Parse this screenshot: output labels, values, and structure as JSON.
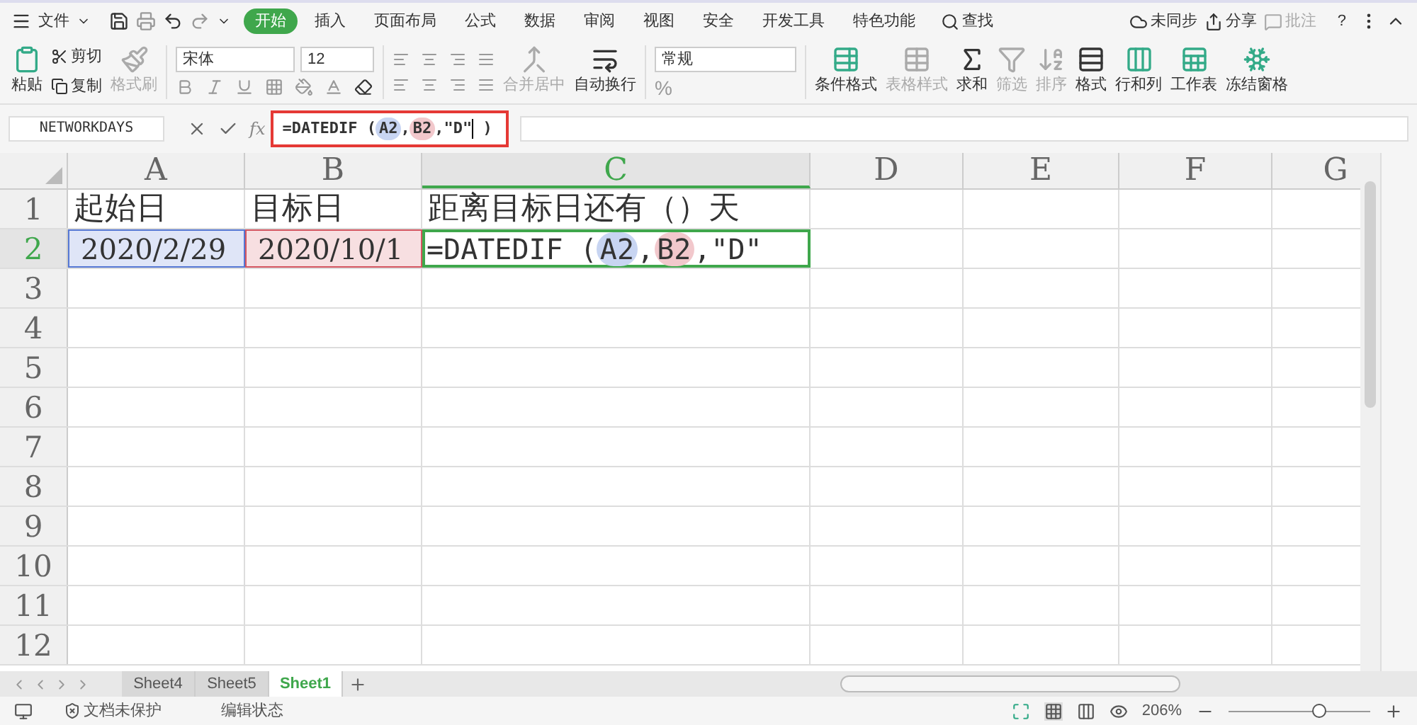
{
  "menu": {
    "file": "文件",
    "tabs": [
      {
        "label": "开始",
        "selected": true
      },
      {
        "label": "插入",
        "selected": false
      },
      {
        "label": "页面布局",
        "selected": false
      },
      {
        "label": "公式",
        "selected": false
      },
      {
        "label": "数据",
        "selected": false
      },
      {
        "label": "审阅",
        "selected": false
      },
      {
        "label": "视图",
        "selected": false
      },
      {
        "label": "安全",
        "selected": false
      },
      {
        "label": "开发工具",
        "selected": false
      },
      {
        "label": "特色功能",
        "selected": false
      }
    ],
    "search": "查找",
    "actions": [
      {
        "label": "未同步",
        "disabled": false
      },
      {
        "label": "分享",
        "disabled": false
      },
      {
        "label": "批注",
        "disabled": true
      }
    ],
    "help": "?"
  },
  "ribbon": {
    "paste": {
      "label": "粘贴",
      "disabled": false
    },
    "clipboard": [
      {
        "label": "剪切",
        "disabled": false
      },
      {
        "label": "复制",
        "disabled": false
      }
    ],
    "format_painter": {
      "label": "格式刷",
      "disabled": true
    },
    "font": "宋体",
    "size": "12",
    "merge": {
      "label": "合并居中",
      "disabled": true
    },
    "wrap": {
      "label": "自动换行",
      "disabled": false
    },
    "number_format": "常规",
    "number_buttons": [
      "%"
    ],
    "tools": [
      {
        "label": "条件格式",
        "disabled": false
      },
      {
        "label": "表格样式",
        "disabled": true
      },
      {
        "label": "求和",
        "disabled": false
      },
      {
        "label": "筛选",
        "disabled": true
      },
      {
        "label": "排序",
        "disabled": true
      },
      {
        "label": "格式",
        "disabled": false
      },
      {
        "label": "行和列",
        "disabled": false
      },
      {
        "label": "工作表",
        "disabled": false
      },
      {
        "label": "冻结窗格",
        "disabled": false
      }
    ]
  },
  "formula_bar": {
    "name_box": "NETWORKDAYS",
    "fx": "fx",
    "parts": [
      {
        "kind": "plain",
        "text": "=DATEDIF ("
      },
      {
        "kind": "ref",
        "text": "A2",
        "color": "#c8d5f2"
      },
      {
        "kind": "plain",
        "text": ","
      },
      {
        "kind": "ref",
        "text": "B2",
        "color": "#f2c8cc"
      },
      {
        "kind": "plain",
        "text": ",\"D\""
      },
      {
        "kind": "cursor"
      },
      {
        "kind": "plain",
        "text": " )"
      }
    ]
  },
  "columns": [
    {
      "label": "A",
      "selected": false
    },
    {
      "label": "B",
      "selected": false
    },
    {
      "label": "C",
      "selected": true
    },
    {
      "label": "D",
      "selected": false
    },
    {
      "label": "E",
      "selected": false
    },
    {
      "label": "F",
      "selected": false
    },
    {
      "label": "G",
      "selected": false
    }
  ],
  "rows": [
    {
      "label": "1",
      "selected": false,
      "cells": [
        {
          "kind": "text",
          "text": "起始日"
        },
        {
          "kind": "text",
          "text": "目标日"
        },
        {
          "kind": "text",
          "text": "距离目标日还有（）天"
        }
      ]
    },
    {
      "label": "2",
      "selected": true,
      "cells": [
        {
          "kind": "ref",
          "text": "2020/2/29",
          "color": "#5577d4"
        },
        {
          "kind": "ref",
          "text": "2020/10/1",
          "color": "#d45560"
        },
        {
          "kind": "editing",
          "parts": [
            {
              "kind": "plain",
              "text": "=DATEDIF ("
            },
            {
              "kind": "ref",
              "text": "A2",
              "color": "#c8d5f2"
            },
            {
              "kind": "plain",
              "text": ","
            },
            {
              "kind": "ref",
              "text": "B2",
              "color": "#f2c8cc"
            },
            {
              "kind": "plain",
              "text": ",\"D\""
            }
          ]
        }
      ]
    },
    {
      "label": "3",
      "selected": false,
      "cells": []
    },
    {
      "label": "4",
      "selected": false,
      "cells": []
    },
    {
      "label": "5",
      "selected": false,
      "cells": []
    },
    {
      "label": "6",
      "selected": false,
      "cells": []
    },
    {
      "label": "7",
      "selected": false,
      "cells": []
    },
    {
      "label": "8",
      "selected": false,
      "cells": []
    },
    {
      "label": "9",
      "selected": false,
      "cells": []
    },
    {
      "label": "10",
      "selected": false,
      "cells": []
    },
    {
      "label": "11",
      "selected": false,
      "cells": []
    },
    {
      "label": "12",
      "selected": false,
      "cells": []
    }
  ],
  "sheets": [
    {
      "label": "Sheet4",
      "selected": false
    },
    {
      "label": "Sheet5",
      "selected": false
    },
    {
      "label": "Sheet1",
      "selected": true
    }
  ],
  "status": {
    "protection": "文档未保护",
    "mode": "编辑状态",
    "zoom": "206%",
    "level": 0.66
  }
}
